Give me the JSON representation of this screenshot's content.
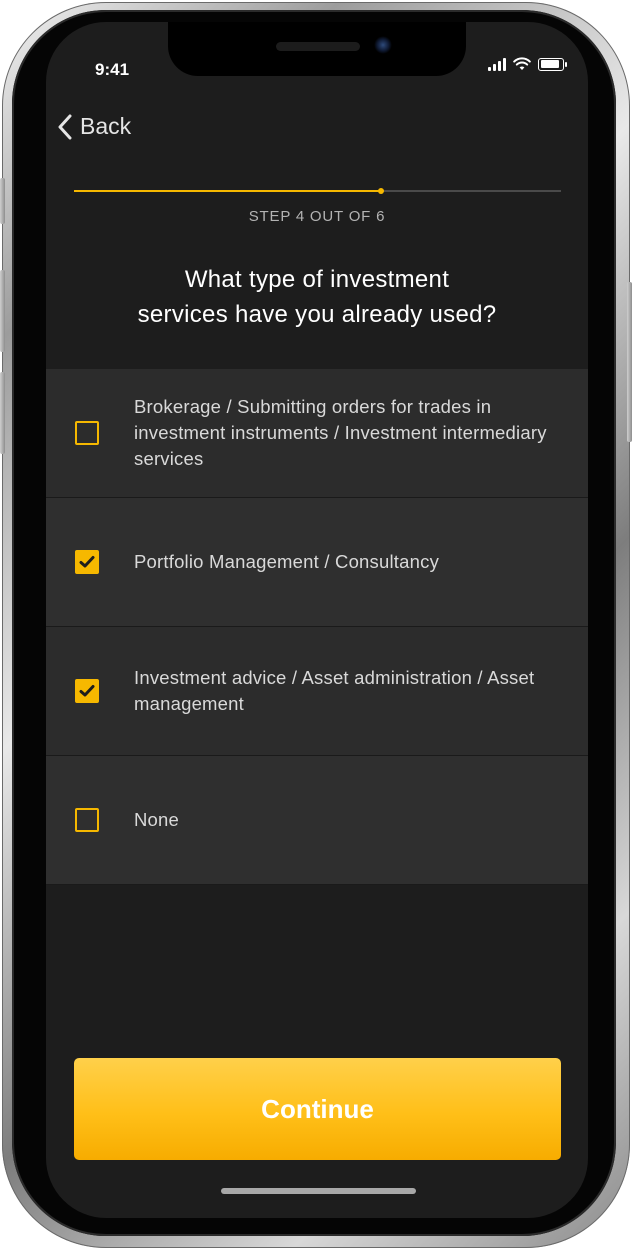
{
  "status_bar": {
    "time": "9:41"
  },
  "nav": {
    "back_label": "Back"
  },
  "progress": {
    "current_step": 4,
    "total_steps": 6,
    "fraction": 0.63,
    "label": "STEP 4 OUT OF 6"
  },
  "question": {
    "line1": "What type of investment",
    "line2": "services have you already used?"
  },
  "options": [
    {
      "label": "Brokerage / Submitting orders for trades in investment instruments / Investment intermediary services",
      "checked": false
    },
    {
      "label": "Portfolio Management / Consultancy",
      "checked": true
    },
    {
      "label": "Investment advice / Asset administration / Asset management",
      "checked": true
    },
    {
      "label": "None",
      "checked": false
    }
  ],
  "actions": {
    "continue_label": "Continue"
  },
  "colors": {
    "accent": "#f6b800",
    "background": "#1d1d1d",
    "row": "#2c2c2c",
    "text": "#d9d9d9"
  },
  "icons": [
    "back-chevron-icon",
    "signal-icon",
    "wifi-icon",
    "battery-icon",
    "checkbox-icon",
    "checkmark-icon"
  ]
}
